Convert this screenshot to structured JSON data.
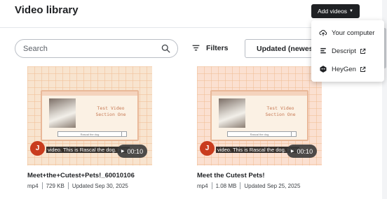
{
  "header": {
    "title": "Video library",
    "add_button_label": "Add videos",
    "add_button_icon": "caret-down-icon"
  },
  "toolbar": {
    "search_placeholder": "Search",
    "filters_label": "Filters",
    "sort_label": "Updated (newest"
  },
  "dropdown_menu": {
    "items": [
      {
        "label": "Your computer",
        "icon": "cloud-upload-icon",
        "external": false
      },
      {
        "label": "Descript",
        "icon": "descript-icon",
        "external": true
      },
      {
        "label": "HeyGen",
        "icon": "heygen-icon",
        "external": true
      }
    ]
  },
  "videos": [
    {
      "title": "Meet+the+Cutest+Pets!_60010106",
      "format": "mp4",
      "size": "729 KB",
      "updated": "Updated Sep 30, 2025",
      "duration": "00:10",
      "avatar_initial": "J",
      "caption": "video. This is Rascal the dog. He's",
      "slide_title": "Test Video\nSection One",
      "slide_search": "Rascal the dog"
    },
    {
      "title": "Meet the Cutest Pets!",
      "format": "mp4",
      "size": "1.08 MB",
      "updated": "Updated Sep 25, 2025",
      "duration": "00:10",
      "avatar_initial": "J",
      "caption": "video. This is Rascal the dog. He's",
      "slide_title": "Test Video\nSection One",
      "slide_search": "Rascal the dog"
    }
  ],
  "colors": {
    "primary_button": "#1f2124",
    "avatar": "#c93c1e",
    "thumbnail_bg": "#f8e4cf"
  }
}
